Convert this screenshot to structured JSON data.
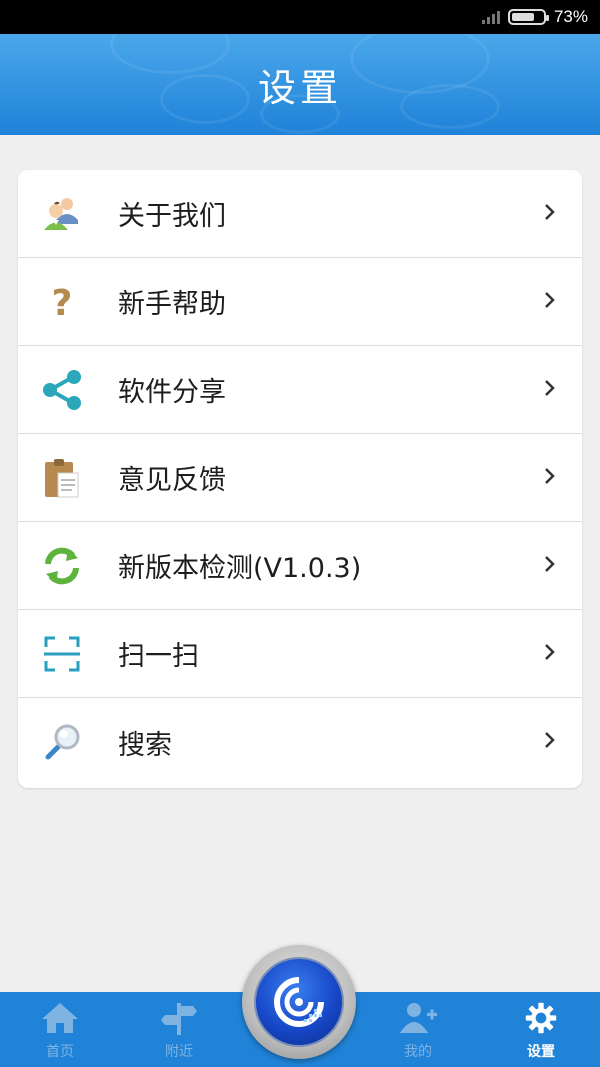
{
  "status_bar": {
    "battery": "73%"
  },
  "header": {
    "title": "设置"
  },
  "menu": {
    "items": [
      {
        "label": "关于我们",
        "icon": "about-us-icon"
      },
      {
        "label": "新手帮助",
        "icon": "question-mark-icon"
      },
      {
        "label": "软件分享",
        "icon": "share-icon"
      },
      {
        "label": "意见反馈",
        "icon": "clipboard-icon"
      },
      {
        "label": "新版本检测(V1.0.3)",
        "icon": "refresh-icon"
      },
      {
        "label": "扫一扫",
        "icon": "scan-icon"
      },
      {
        "label": "搜索",
        "icon": "magnifier-icon"
      }
    ]
  },
  "bottom_nav": {
    "items": [
      {
        "label": "首页",
        "icon": "home-icon",
        "active": false
      },
      {
        "label": "附近",
        "icon": "signpost-icon",
        "active": false
      },
      {
        "label": "我的",
        "icon": "add-user-icon",
        "active": false
      },
      {
        "label": "设置",
        "icon": "gear-icon",
        "active": true
      }
    ],
    "center_icon": "app-logo-icon"
  },
  "colors": {
    "header_blue": "#2083d8",
    "nav_inactive": "#7fb3e2",
    "nav_active": "#ffffff",
    "share_teal": "#2aa7b8",
    "refresh_green": "#5db33c"
  }
}
